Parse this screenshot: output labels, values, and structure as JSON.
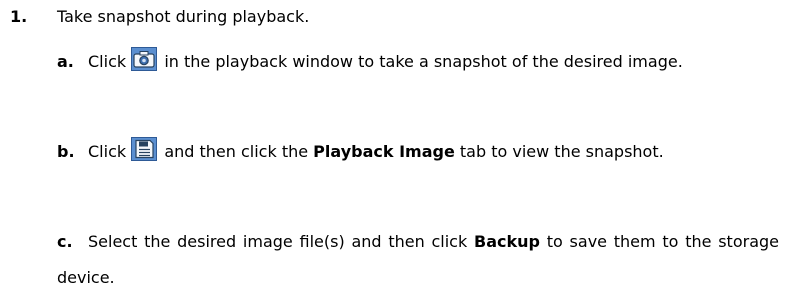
{
  "step": {
    "number": "1.",
    "text": "Take snapshot during playback."
  },
  "substeps": {
    "a": {
      "marker": "a.",
      "click": "Click",
      "icon": "camera-icon",
      "rest": "in the playback window to take a snapshot of the desired image."
    },
    "b": {
      "marker": "b.",
      "click": "Click",
      "icon": "save-disk-icon",
      "mid": "and then click the",
      "bold": "Playback Image",
      "rest": "tab to view the snapshot."
    },
    "c": {
      "marker": "c.",
      "pre": "Select the desired image file(s) and then click",
      "bold": "Backup",
      "rest": "to save them to the storage device."
    }
  },
  "colors": {
    "icon_background": "#5b8fd0",
    "icon_border": "#2e5a96"
  }
}
